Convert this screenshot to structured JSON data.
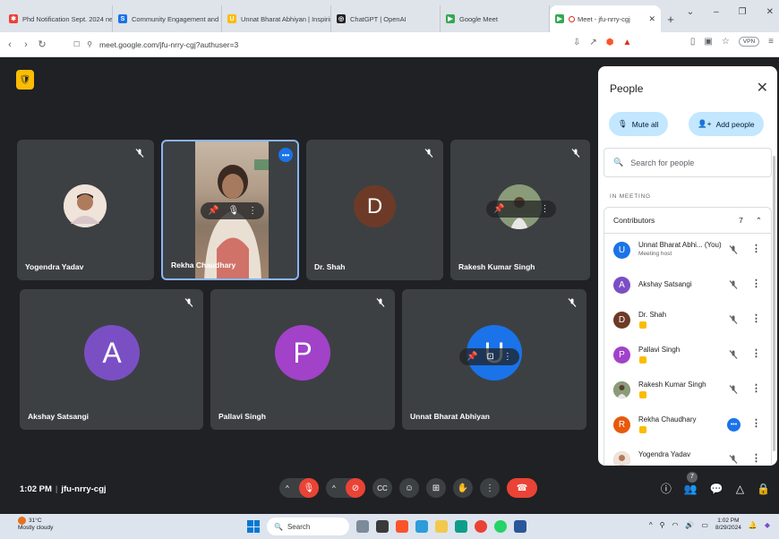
{
  "browser": {
    "tabs": [
      {
        "label": "Phd Notification Sept. 2024 ne...",
        "fav_color": "#ea4335",
        "fav_glyph": "✱"
      },
      {
        "label": "Community Engagement and S...",
        "fav_color": "#1a73e8",
        "fav_glyph": "S"
      },
      {
        "label": "Unnat Bharat Abhiyan | Inspiring...",
        "fav_color": "#fbbc04",
        "fav_glyph": "U"
      },
      {
        "label": "ChatGPT | OpenAI",
        "fav_color": "#202124",
        "fav_glyph": "◎"
      },
      {
        "label": "Google Meet",
        "fav_color": "#34a853",
        "fav_glyph": "▶"
      },
      {
        "label": "Meet - jfu-nrry-cgj",
        "fav_color": "#34a853",
        "fav_glyph": "▶"
      }
    ],
    "url": "meet.google.com/jfu-nrry-cgj?authuser=3",
    "vpn_label": "VPN"
  },
  "meeting": {
    "time": "1:02 PM",
    "code": "jfu-nrry-cgj",
    "participant_count": "7"
  },
  "tiles": [
    {
      "name": "Yogendra Yadav",
      "kind": "photo",
      "photo_color": "#c9a48c"
    },
    {
      "name": "Rekha Chaudhary",
      "kind": "video",
      "speaking": true
    },
    {
      "name": "Dr. Shah",
      "kind": "letter",
      "letter": "D",
      "color": "#6d3a27"
    },
    {
      "name": "Rakesh Kumar Singh",
      "kind": "photo",
      "photo_color": "#6c7a5a"
    },
    {
      "name": "Akshay Satsangi",
      "kind": "letter",
      "letter": "A",
      "color": "#7b4fc4"
    },
    {
      "name": "Pallavi Singh",
      "kind": "letter",
      "letter": "P",
      "color": "#a142c9"
    },
    {
      "name": "Unnat Bharat Abhiyan",
      "kind": "letter",
      "letter": "U",
      "color": "#1a73e8"
    }
  ],
  "panel": {
    "title": "People",
    "mute_all": "Mute all",
    "add_people": "Add people",
    "search_placeholder": "Search for people",
    "section_label": "IN MEETING",
    "group_label": "Contributors",
    "group_count": "7",
    "people": [
      {
        "name": "Unnat Bharat Abhi... (You)",
        "sub": "Meeting host",
        "letter": "U",
        "color": "#1a73e8",
        "tag": false
      },
      {
        "name": "Akshay Satsangi",
        "sub": "",
        "letter": "A",
        "color": "#7b4fc4",
        "tag": false
      },
      {
        "name": "Dr. Shah",
        "sub": "",
        "letter": "D",
        "color": "#6d3a27",
        "tag": true
      },
      {
        "name": "Pallavi Singh",
        "sub": "",
        "letter": "P",
        "color": "#a142c9",
        "tag": true
      },
      {
        "name": "Rakesh Kumar Singh",
        "sub": "",
        "letter": "",
        "color": "#6c7a5a",
        "tag": true
      },
      {
        "name": "Rekha Chaudhary",
        "sub": "",
        "letter": "R",
        "color": "#e8590c",
        "tag": true
      },
      {
        "name": "Yogendra Yadav",
        "sub": "",
        "letter": "",
        "color": "#c9a48c",
        "tag": false
      }
    ]
  },
  "taskbar": {
    "weather_temp": "31°C",
    "weather_desc": "Mostly cloudy",
    "search_label": "Search",
    "clock_time": "1:02 PM",
    "clock_date": "8/29/2024"
  }
}
